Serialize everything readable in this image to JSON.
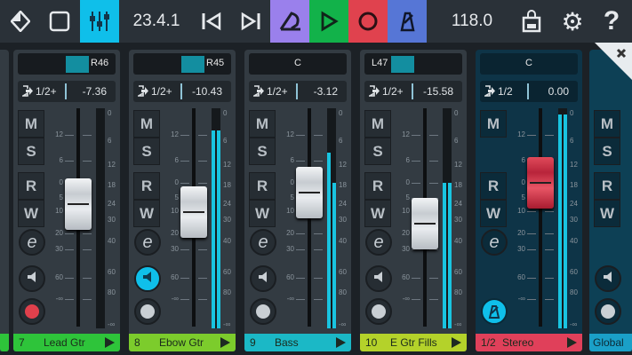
{
  "toolbar": {
    "position": "23.4.1",
    "tempo": "118.0",
    "icons": [
      "project-diamond-icon",
      "tablet-view-icon",
      "mixer-icon",
      "rewind-to-start-icon",
      "forward-to-end-icon",
      "loop-icon",
      "play-icon",
      "record-icon",
      "metronome-icon",
      "shop-bag-icon",
      "gear-icon",
      "help-icon"
    ],
    "colors": {
      "mixer": "#0fbfea",
      "loop": "#9a80ec",
      "play": "#12b24a",
      "record": "#e0424e",
      "metronome": "#5676d6"
    }
  },
  "fader_scale": [
    "12",
    "6",
    "0",
    "5",
    "10",
    "20",
    "30",
    "60",
    "-∞"
  ],
  "meter_scale": [
    "0",
    "6",
    "12",
    "18",
    "24",
    "30",
    "40",
    "60",
    "80",
    "-∞"
  ],
  "channels": [
    {
      "number": "7",
      "name": "Lead Gtr",
      "pan": "R46",
      "pan_side": "R",
      "send_bus": "1/2+",
      "send_value": "-7.36",
      "gain_db": -7.36,
      "meter": [
        0,
        0
      ],
      "color": "#2ec43a",
      "mute": "M",
      "solo": "S",
      "read": "R",
      "write": "W",
      "monitor_active": false,
      "record_armed": true
    },
    {
      "number": "8",
      "name": "Ebow Gtr",
      "pan": "R45",
      "pan_side": "R",
      "send_bus": "1/2+",
      "send_value": "-10.43",
      "gain_db": -10.43,
      "meter": [
        0.9,
        0.9
      ],
      "color": "#7ccc2c",
      "mute": "M",
      "solo": "S",
      "read": "R",
      "write": "W",
      "monitor_active": true,
      "record_armed": false
    },
    {
      "number": "9",
      "name": "Bass",
      "pan": "C",
      "pan_side": "C",
      "send_bus": "1/2+",
      "send_value": "-3.12",
      "gain_db": -3.12,
      "meter": [
        0.8,
        0.66
      ],
      "color": "#1bb8c6",
      "mute": "M",
      "solo": "S",
      "read": "R",
      "write": "W",
      "monitor_active": false,
      "record_armed": false
    },
    {
      "number": "10",
      "name": "E Gtr Fills",
      "pan": "L47",
      "pan_side": "L",
      "send_bus": "1/2+",
      "send_value": "-15.58",
      "gain_db": -15.58,
      "meter": [
        0.66,
        0.66
      ],
      "color": "#b4d22a",
      "mute": "M",
      "solo": "S",
      "read": "R",
      "write": "W",
      "monitor_active": false,
      "record_armed": false
    }
  ],
  "stereo": {
    "number": "1/2",
    "name": "Stereo",
    "pan": "C",
    "send_bus": "1/2",
    "send_value": "0.00",
    "gain_db": 0,
    "meter": [
      0.97,
      0.97
    ],
    "color": "#e0405a",
    "mute": "M",
    "read": "R",
    "write": "W"
  },
  "global": {
    "name": "Global",
    "color": "#1aa0c8",
    "mute": "M",
    "solo": "S",
    "read": "R",
    "write": "W"
  }
}
